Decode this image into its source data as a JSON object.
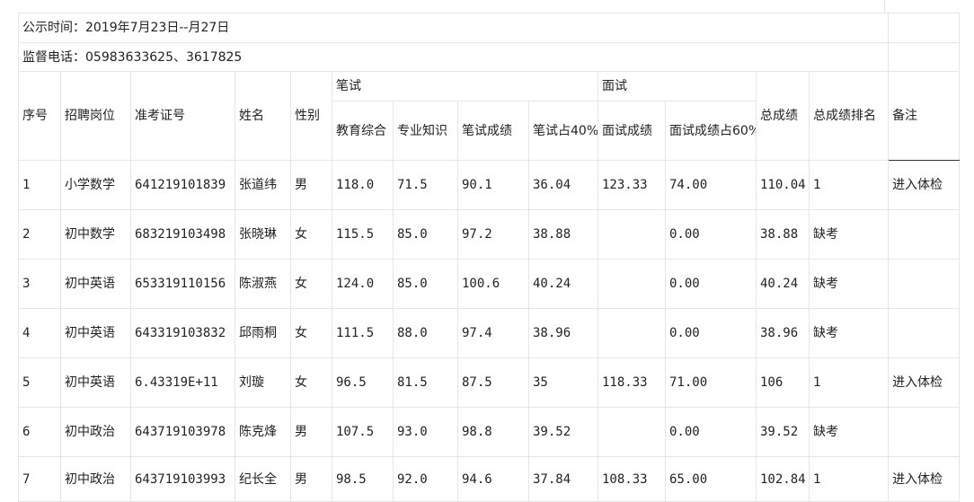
{
  "notice": {
    "publish_time": "公示时间：2019年7月23日--月27日",
    "phone": "监督电话：05983633625、3617825"
  },
  "headers": {
    "seq": "序号",
    "position": "招聘岗位",
    "ticket": "准考证号",
    "name": "姓名",
    "gender": "性别",
    "written_group": "笔试",
    "edu": "教育综合",
    "prof": "专业知识",
    "written_score": "笔试成绩",
    "written_40": "笔试占40%",
    "interview_group": "面试",
    "interview_score": "面试成绩",
    "interview_60": "面试成绩占60%",
    "total": "总成绩",
    "rank": "总成绩排名",
    "remark": "备注"
  },
  "rows": [
    {
      "seq": "1",
      "position": "小学数学",
      "ticket": "641219101839",
      "name": "张道纬",
      "gender": "男",
      "edu": "118.0",
      "prof": "71.5",
      "written": "90.1",
      "w40": "36.04",
      "interview": "123.33",
      "i60": "74.00",
      "total": "110.04",
      "rank": "1",
      "remark": "进入体检"
    },
    {
      "seq": "2",
      "position": "初中数学",
      "ticket": "683219103498",
      "name": "张晓琳",
      "gender": "女",
      "edu": "115.5",
      "prof": "85.0",
      "written": "97.2",
      "w40": "38.88",
      "interview": "",
      "i60": "0.00",
      "total": "38.88",
      "rank": "缺考",
      "remark": ""
    },
    {
      "seq": "3",
      "position": "初中英语",
      "ticket": "653319110156",
      "name": "陈淑燕",
      "gender": "女",
      "edu": "124.0",
      "prof": "85.0",
      "written": "100.6",
      "w40": "40.24",
      "interview": "",
      "i60": "0.00",
      "total": "40.24",
      "rank": "缺考",
      "remark": ""
    },
    {
      "seq": "4",
      "position": "初中英语",
      "ticket": "643319103832",
      "name": "邱雨桐",
      "gender": "女",
      "edu": "111.5",
      "prof": "88.0",
      "written": "97.4",
      "w40": "38.96",
      "interview": "",
      "i60": "0.00",
      "total": "38.96",
      "rank": "缺考",
      "remark": ""
    },
    {
      "seq": "5",
      "position": "初中英语",
      "ticket": "6.43319E+11",
      "name": "刘璇",
      "gender": "女",
      "edu": "96.5",
      "prof": "81.5",
      "written": "87.5",
      "w40": "35",
      "interview": "118.33",
      "i60": "71.00",
      "total": "106",
      "rank": "1",
      "remark": "进入体检"
    },
    {
      "seq": "6",
      "position": "初中政治",
      "ticket": "643719103978",
      "name": "陈克烽",
      "gender": "男",
      "edu": "107.5",
      "prof": "93.0",
      "written": "98.8",
      "w40": "39.52",
      "interview": "",
      "i60": "0.00",
      "total": "39.52",
      "rank": "缺考",
      "remark": ""
    },
    {
      "seq": "7",
      "position": "初中政治",
      "ticket": "643719103993",
      "name": "纪长全",
      "gender": "男",
      "edu": "98.5",
      "prof": "92.0",
      "written": "94.6",
      "w40": "37.84",
      "interview": "108.33",
      "i60": "65.00",
      "total": "102.84",
      "rank": "1",
      "remark": "进入体检"
    }
  ]
}
